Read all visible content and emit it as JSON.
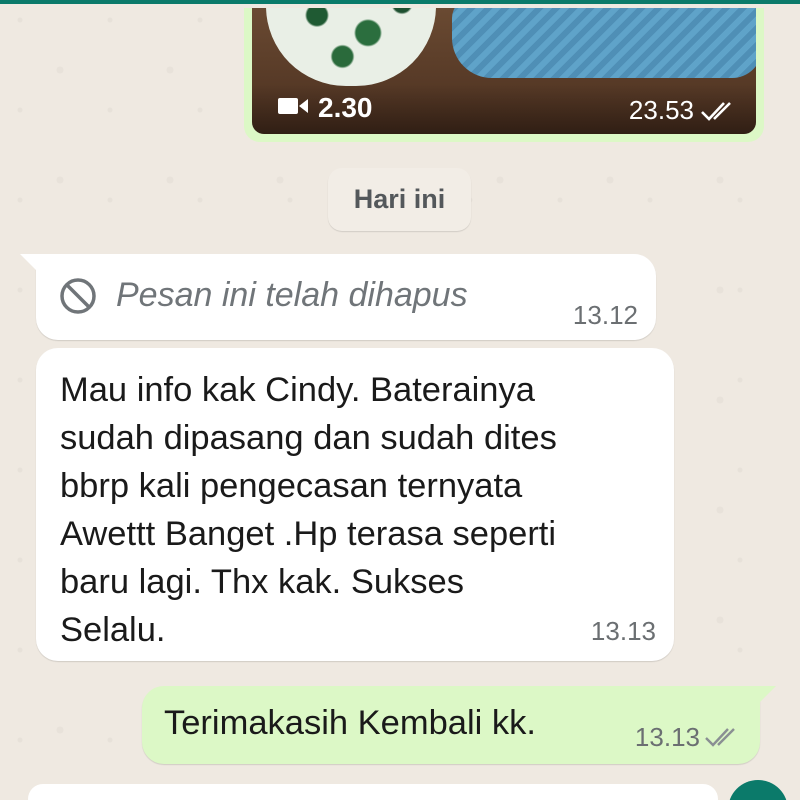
{
  "video_message": {
    "duration": "2.30",
    "time": "23.53",
    "status_icon": "double-check-icon"
  },
  "date_divider": {
    "label": "Hari ini"
  },
  "deleted_message": {
    "text": "Pesan ini telah dihapus",
    "time": "13.12",
    "icon": "blocked-icon"
  },
  "incoming_message": {
    "lines": [
      "Mau info kak Cindy. Baterainya",
      "sudah dipasang dan sudah dites",
      "bbrp kali pengecasan ternyata",
      "Awettt Banget .Hp terasa seperti",
      "baru lagi. Thx kak. Sukses",
      "Selalu."
    ],
    "time": "13.13"
  },
  "outgoing_message": {
    "text": "Terimakasih Kembali kk.",
    "time": "13.13",
    "status_icon": "double-check-icon"
  },
  "colors": {
    "outgoing_bubble": "#dcf8c6",
    "incoming_bubble": "#ffffff",
    "accent": "#0b7a6a",
    "chat_background": "#efe9e1"
  }
}
